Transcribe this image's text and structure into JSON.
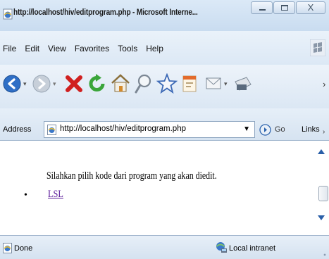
{
  "window": {
    "title": "http://localhost/hiv/editprogram.php - Microsoft Interne...",
    "close_label": "X"
  },
  "menu": {
    "items": [
      {
        "label": "File"
      },
      {
        "label": "Edit"
      },
      {
        "label": "View"
      },
      {
        "label": "Favorites"
      },
      {
        "label": "Tools"
      },
      {
        "label": "Help"
      }
    ]
  },
  "toolbar": {
    "icons": [
      "back-icon",
      "forward-icon",
      "stop-icon",
      "refresh-icon",
      "home-icon",
      "search-icon",
      "favorites-icon",
      "history-icon",
      "mail-icon",
      "print-icon"
    ]
  },
  "address": {
    "label": "Address",
    "url": "http://localhost/hiv/editprogram.php",
    "dropdown_glyph": "▼",
    "go_label": "Go",
    "links_label": "Links",
    "links_chevron": "›"
  },
  "page": {
    "intro": "Silahkan pilih kode dari program yang akan diedit.",
    "bullet": "•",
    "program_links": [
      {
        "label": "LSL"
      }
    ]
  },
  "status": {
    "text": "Done",
    "zone": "Local intranet"
  },
  "colors": {
    "link_visited": "#5a1a9a",
    "chrome_blue": "#dce8f5"
  }
}
